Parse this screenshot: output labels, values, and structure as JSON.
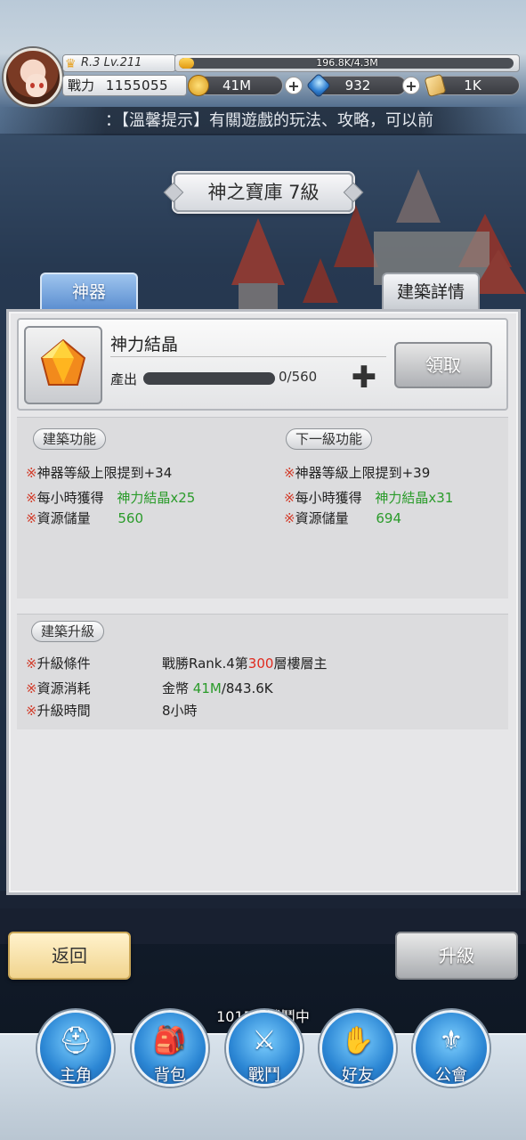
{
  "header": {
    "rank": "R.3",
    "level": "Lv.211",
    "exp_text": "196.8K/4.3M",
    "exp_fraction": 0.046,
    "power_label": "戰力",
    "power_value": "1155055",
    "gold": "41M",
    "gems": "932",
    "tickets": "1K"
  },
  "ticker": {
    "text": "：【溫馨提示】有關遊戲的玩法、攻略，可以前"
  },
  "title": "神之寶庫 7級",
  "tabs": {
    "left": "神器",
    "right": "建築詳情"
  },
  "production": {
    "name": "神力結晶",
    "output_label": "產出",
    "count": "0/560",
    "progress_fraction": 0,
    "claim_label": "領取"
  },
  "function": {
    "current_title": "建築功能",
    "next_title": "下一級功能",
    "current": [
      {
        "label": "神器等級上限提到+34",
        "value": ""
      },
      {
        "label": "每小時獲得",
        "value": "神力結晶x25"
      },
      {
        "label": "資源儲量",
        "value": "560"
      }
    ],
    "next": [
      {
        "label": "神器等級上限提到+39",
        "value": ""
      },
      {
        "label": "每小時獲得",
        "value": "神力結晶x31"
      },
      {
        "label": "資源儲量",
        "value": "694"
      }
    ]
  },
  "upgrade": {
    "title": "建築升級",
    "condition_label": "升級條件",
    "condition_prefix": "戰勝Rank.4第",
    "condition_floor": "300",
    "condition_suffix": "層樓層主",
    "cost_label": "資源消耗",
    "cost_prefix": "金幣 ",
    "cost_have": "41M",
    "cost_need": "/843.6K",
    "time_label": "升級時間",
    "time_value": "8小時"
  },
  "buttons": {
    "back": "返回",
    "upgrade": "升級"
  },
  "battle_status": "1015層戰鬥中",
  "nav": [
    {
      "label": "主角",
      "icon": "knight-helmet-icon"
    },
    {
      "label": "背包",
      "icon": "backpack-icon"
    },
    {
      "label": "戰鬥",
      "icon": "crossed-swords-icon"
    },
    {
      "label": "好友",
      "icon": "handshake-icon"
    },
    {
      "label": "公會",
      "icon": "guild-crest-icon"
    }
  ],
  "colors": {
    "highlight_green": "#2a9b2a",
    "highlight_red": "#e02a1e",
    "mark_red": "#d23c2a",
    "nav_blue": "#2b86d4"
  }
}
